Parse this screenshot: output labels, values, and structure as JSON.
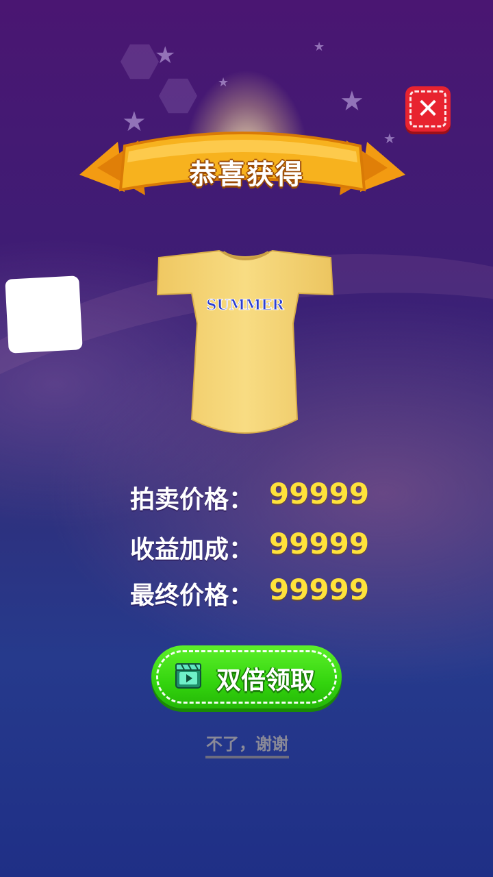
{
  "popup": {
    "title": "恭喜获得",
    "item": {
      "name": "summer-dress",
      "print_text": "SUMMER",
      "color": "#f6d873"
    }
  },
  "stats": [
    {
      "label": "拍卖价格：",
      "value": "99999"
    },
    {
      "label": "收益加成：",
      "value": "99999"
    },
    {
      "label": "最终价格：",
      "value": "99999"
    }
  ],
  "buttons": {
    "double_claim_label": "双倍领取",
    "decline_label": "不了，谢谢",
    "close_icon": "close-icon"
  },
  "colors": {
    "accent_yellow": "#ffe23b",
    "button_green": "#33d40e",
    "close_red": "#e8232f",
    "ribbon_orange": "#f7a51a"
  }
}
